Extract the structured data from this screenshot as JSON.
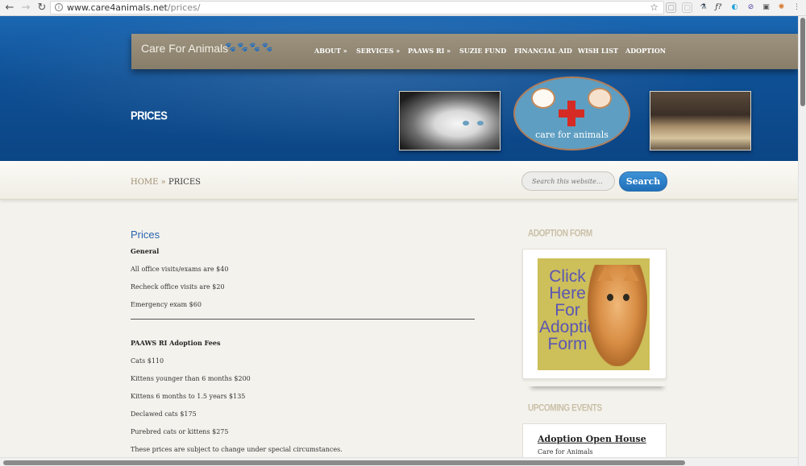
{
  "browser": {
    "url_host": "www.care4animals.net",
    "url_path": "/prices/",
    "back_icon": "back-arrow-icon",
    "forward_icon": "forward-arrow-icon",
    "reload_icon": "reload-icon",
    "star_icon": "bookmark-star-icon",
    "menu_icon": "more-vertical-icon"
  },
  "header": {
    "logo_text": "Care For Animals",
    "paws": "🐾 🐾 🐾 🐾",
    "nav": [
      "ABOUT »",
      "SERVICES »",
      "PAAWS RI »",
      "SUZIE FUND",
      "FINANCIAL AID",
      "WISH LIST",
      "ADOPTION"
    ],
    "page_heading": "PRICES",
    "badge_text": "care for animals"
  },
  "breadcrumb": {
    "home": "HOME",
    "separator": "»",
    "current": "PRICES"
  },
  "search": {
    "placeholder": "Search this website…",
    "button_label": "Search"
  },
  "content": {
    "title": "Prices",
    "general_heading": "General",
    "general_items": [
      "All office visits/exams are $40",
      "Recheck office visits are $20",
      "Emergency exam $60"
    ],
    "adoption_heading": "PAAWS RI Adoption Fees",
    "adoption_items": [
      "Cats $110",
      "Kittens younger than 6 months $200",
      "Kittens 6 months to 1.5 years $135",
      "Declawed cats $175",
      "Purebred cats or kittens $275",
      "These prices are subject to change under special circumstances."
    ]
  },
  "sidebar": {
    "adoption_form_heading": "ADOPTION FORM",
    "adoption_form_image_text": "Click Here For Adoption Form",
    "upcoming_events_heading": "UPCOMING EVENTS",
    "event_title": "Adoption Open House",
    "event_org": "Care for Animals"
  },
  "colors": {
    "header_blue": "#0e4f94",
    "nav_bar": "#8f8571",
    "link_blue": "#2a64b0",
    "search_button": "#2a7bc5",
    "breadcrumb_tan": "#a08e70"
  }
}
